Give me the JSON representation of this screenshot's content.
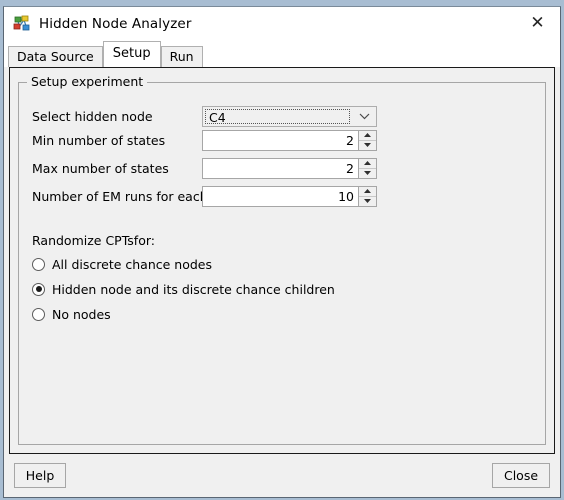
{
  "window": {
    "title": "Hidden Node Analyzer",
    "icon": "network-nodes-icon",
    "close_icon": "close-icon"
  },
  "tabs": [
    {
      "label": "Data Source",
      "active": false
    },
    {
      "label": "Setup",
      "active": true
    },
    {
      "label": "Run",
      "active": false
    }
  ],
  "groupbox": {
    "title": "Setup experiment"
  },
  "fields": {
    "hidden_node": {
      "label": "Select hidden node",
      "value": "C4",
      "dropdown_icon": "chevron-down-icon"
    },
    "min_states": {
      "label": "Min number of states",
      "value": "2"
    },
    "max_states": {
      "label": "Max number of states",
      "value": "2"
    },
    "em_runs": {
      "label": "Number of EM runs for each state",
      "value": "10"
    }
  },
  "randomize": {
    "label": "Randomize CPTsfor:",
    "options": [
      {
        "label": "All discrete chance nodes",
        "checked": false
      },
      {
        "label": "Hidden node and its discrete chance children",
        "checked": true
      },
      {
        "label": "No nodes",
        "checked": false
      }
    ]
  },
  "footer": {
    "help_label": "Help",
    "close_label": "Close"
  },
  "colors": {
    "window_background": "#f0f0f0",
    "titlebar_background": "#ffffff",
    "desktop_background": "#a8bdd2",
    "panel_border": "#1a1a1a",
    "control_border": "#a6a6a6"
  }
}
